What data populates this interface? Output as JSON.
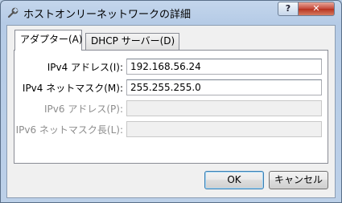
{
  "window": {
    "title": "ホストオンリーネットワークの詳細",
    "help_label": "?",
    "close_label": "✕"
  },
  "tabs": [
    {
      "label": "アダプター(A)",
      "active": true
    },
    {
      "label": "DHCP サーバー(D)",
      "active": false
    }
  ],
  "adapter": {
    "ipv4_address_label": "IPv4 アドレス(I):",
    "ipv4_address_value": "192.168.56.24",
    "ipv4_mask_label": "IPv4 ネットマスク(M):",
    "ipv4_mask_value": "255.255.255.0",
    "ipv6_address_label": "IPv6 アドレス(P):",
    "ipv6_address_value": "",
    "ipv6_prefix_label": "IPv6 ネットマスク長(L):",
    "ipv6_prefix_value": ""
  },
  "buttons": {
    "ok": "OK",
    "cancel": "キャンセル"
  }
}
